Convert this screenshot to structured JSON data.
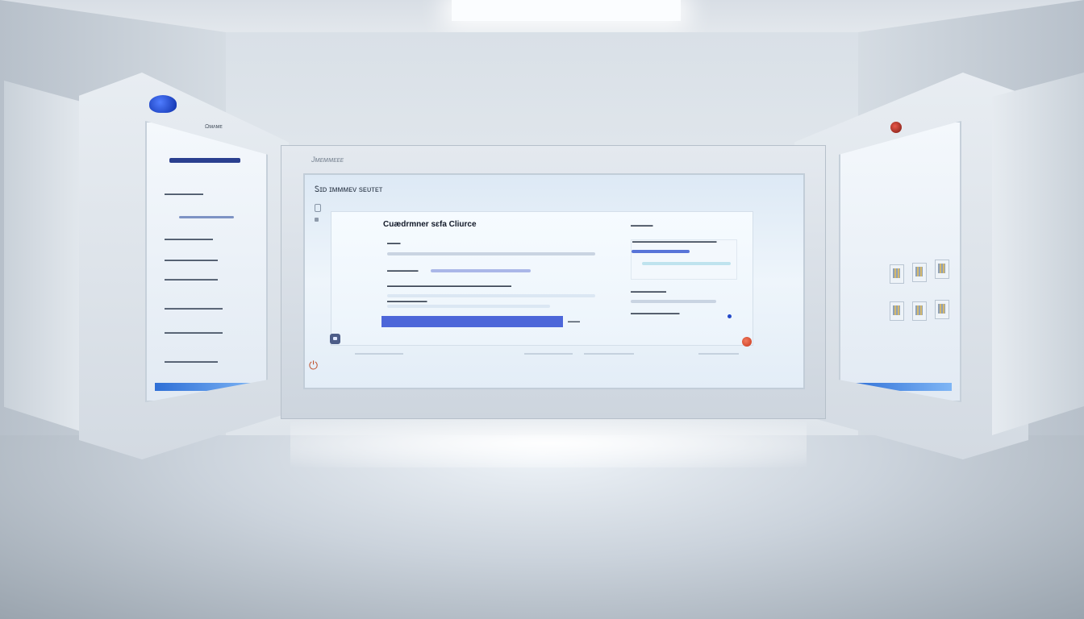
{
  "scene": {
    "accent_color": "#4c66d9",
    "alert_color": "#d24a2d"
  },
  "left_panel": {
    "brand": "Ωᴍᴧᴍᴇ",
    "rows": [
      "▬▬▬▬▬▬▬▬",
      "▬▬▬▬▬▬▬▬▬▬",
      "▬▬▬▬▬▬▬▬▬▬▬",
      "▬▬▬▬▬▬▬▬▬▬▬",
      "▬▬▬▬▬▬▬▬▬▬▬▬",
      "▬▬▬▬▬▬▬▬▬▬▬▬",
      "▬▬▬▬▬▬▬▬▬▬▬"
    ]
  },
  "monitor": {
    "brand": "Јᴍᴇᴍᴍᴇᴇᴇ",
    "app_title": "Ꮪɪᴅ ɪᴍᴍᴍᴇᴠ sᴇᴜᴛᴇᴛ",
    "form": {
      "title": "Cuædrmner sɛfa Cliurce",
      "labels": [
        "▬▬▬",
        "▬▬▬▬▬▬▬▬▬▬▬▬▬▬▬▬▬▬▬▬▬▬▬▬▬▬▬▬",
        "▬▬▬▬▬▬▬",
        "▬▬▬▬▬▬▬▬▬▬▬▬",
        "▬▬▬▬▬▬▬▬▬"
      ],
      "submit_side_label": "▬▬▬"
    },
    "side_card": {
      "heading": "▬▬▬▬▬",
      "line": "▬▬▬▬▬▬▬▬▬▬▬▬▬▬▬▬▬▬▬",
      "subheading": "▬▬▬▬▬▬▬▬",
      "subline": "▬▬▬▬▬▬▬▬▬▬▬"
    }
  },
  "icons": {
    "chat": "chat-icon",
    "power": "power-icon",
    "alert": "alert-dot-icon"
  }
}
